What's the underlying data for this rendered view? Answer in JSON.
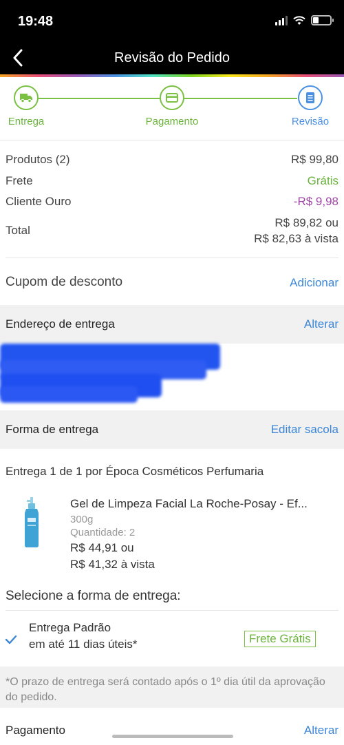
{
  "status_bar": {
    "time": "19:48"
  },
  "header": {
    "title": "Revisão do Pedido"
  },
  "stepper": {
    "steps": [
      {
        "label": "Entrega"
      },
      {
        "label": "Pagamento"
      },
      {
        "label": "Revisão"
      }
    ]
  },
  "summary": {
    "products_label": "Produtos (2)",
    "products_value": "R$ 99,80",
    "shipping_label": "Frete",
    "shipping_value": "Grátis",
    "gold_label": "Cliente Ouro",
    "gold_value": "-R$ 9,98",
    "total_label": "Total",
    "total_value": "R$ 89,82 ou",
    "total_cash": "R$ 82,63 à vista"
  },
  "coupon": {
    "label": "Cupom de desconto",
    "action": "Adicionar"
  },
  "address": {
    "title": "Endereço de entrega",
    "action": "Alterar"
  },
  "delivery": {
    "title": "Forma de entrega",
    "action": "Editar sacola",
    "shipment": "Entrega 1 de 1",
    "seller_prefix": "por",
    "seller": "Época Cosméticos Perfumaria",
    "product": {
      "name": "Gel de Limpeza Facial La Roche-Posay - Ef...",
      "size": "300g",
      "quantity": "Quantidade: 2",
      "price": "R$ 44,91 ou",
      "price_cash": "R$ 41,32 à vista"
    },
    "select_label": "Selecione a forma de entrega:",
    "option": {
      "name": "Entrega Padrão",
      "eta": "em até 11 dias úteis*",
      "badge": "Frete Grátis"
    },
    "note": "*O prazo de entrega será contado após o 1º dia útil da aprovação do pedido."
  },
  "payment": {
    "title": "Pagamento",
    "action": "Alterar"
  },
  "colors": {
    "green": "#6cb33e",
    "blue": "#3b86d6",
    "purple": "#a046a8",
    "header_bg": "#000000"
  }
}
